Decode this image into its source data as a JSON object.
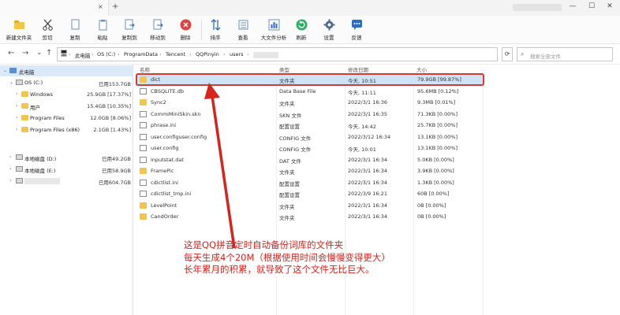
{
  "titlebar": {
    "tab_title": "",
    "close_glyph": "×",
    "new_tab_glyph": "+",
    "min_glyph": "—",
    "max_glyph": "☐",
    "close_win_glyph": "✕"
  },
  "ribbon": {
    "new_folder": "新建文件夹",
    "cut": "剪切",
    "copy": "复制",
    "paste": "粘贴",
    "copy_to": "复制到",
    "move_to": "移动到",
    "delete": "删除",
    "sort": "排序",
    "view": "查看",
    "large_file_analysis": "大文件分析",
    "refresh": "刷新",
    "settings": "设置",
    "feedback": "反馈"
  },
  "nav": {
    "back": "←",
    "forward": "→",
    "up": "↑",
    "refresh": "⟳"
  },
  "address": {
    "segments": [
      "此电脑",
      "OS (C:)",
      "ProgramData",
      "Tencent",
      "QQPinyin",
      "users"
    ],
    "separator": "›"
  },
  "search": {
    "placeholder": "搜索全部文件"
  },
  "sidebar": {
    "this_pc": "此电脑",
    "items": [
      {
        "label": "OS (C:)",
        "value": "已用153.7GB"
      },
      {
        "label": "Windows",
        "value": "25.9GB [17.37%]"
      },
      {
        "label": "用户",
        "value": "15.4GB [10.35%]"
      },
      {
        "label": "Program Files",
        "value": "12.0GB [8.06%]"
      },
      {
        "label": "Program Files (x86)",
        "value": "2.1GB [1.43%]"
      },
      {
        "label": "本地磁盘 (D:)",
        "value": "已用49.2GB"
      },
      {
        "label": "本地磁盘 (E:)",
        "value": "已用58.9GB"
      },
      {
        "label": "",
        "value": "已用604.7GB"
      }
    ]
  },
  "filelist": {
    "headers": {
      "name": "名称",
      "type": "类型",
      "modified": "修改日期",
      "size": "大小"
    },
    "rows": [
      {
        "name": "dict",
        "type": "文件夹",
        "modified": "今天, 10:51",
        "size": "79.9GB [99.87%]",
        "kind": "folder"
      },
      {
        "name": "CBSQLITE.db",
        "type": "Data Base File",
        "modified": "今天, 11:11",
        "size": "95.6MB [0.12%]",
        "kind": "file"
      },
      {
        "name": "Sync2",
        "type": "文件夹",
        "modified": "2022/3/1 16:36",
        "size": "9.3MB [0.01%]",
        "kind": "folder"
      },
      {
        "name": "CommiMiniSkin.skn",
        "type": "SKN 文件",
        "modified": "2022/3/1 16:35",
        "size": "71.3KB [0.00%]",
        "kind": "file"
      },
      {
        "name": "phrase.ini",
        "type": "配置设置",
        "modified": "今天, 14:42",
        "size": "25.7KB [0.00%]",
        "kind": "file"
      },
      {
        "name": "user.configuser.config",
        "type": "CONFIG 文件",
        "modified": "2022/3/12 16:34",
        "size": "13.1KB [0.00%]",
        "kind": "file"
      },
      {
        "name": "user.config",
        "type": "CONFIG 文件",
        "modified": "今天, 10:01",
        "size": "13.1KB [0.00%]",
        "kind": "file"
      },
      {
        "name": "inputstat.dat",
        "type": "DAT 文件",
        "modified": "2022/3/1 16:34",
        "size": "5.0KB [0.00%]",
        "kind": "file"
      },
      {
        "name": "FramePic",
        "type": "文件夹",
        "modified": "2022/3/1 16:34",
        "size": "3.9KB [0.00%]",
        "kind": "folder"
      },
      {
        "name": "cdictlist.ini",
        "type": "配置设置",
        "modified": "2022/3/1 16:34",
        "size": "1.3KB [0.00%]",
        "kind": "file"
      },
      {
        "name": "cdictlist_tmp.ini",
        "type": "配置设置",
        "modified": "2022/3/9 16:21",
        "size": "60B [0.00%]",
        "kind": "file"
      },
      {
        "name": "LevelPoint",
        "type": "文件夹",
        "modified": "2022/3/1 16:34",
        "size": "0B [0.00%]",
        "kind": "folder"
      },
      {
        "name": "CandOrder",
        "type": "文件夹",
        "modified": "2022/3/1 16:34",
        "size": "0B [0.00%]",
        "kind": "folder"
      }
    ]
  },
  "annotation": {
    "line1": "这是QQ拼音定时自动备份词库的文件夹",
    "line2": "每天生成4个20M（根据使用时间会慢慢变得更大）",
    "line3": "长年累月的积累，就导致了这个文件无比巨大。",
    "color": "#d6231c"
  }
}
